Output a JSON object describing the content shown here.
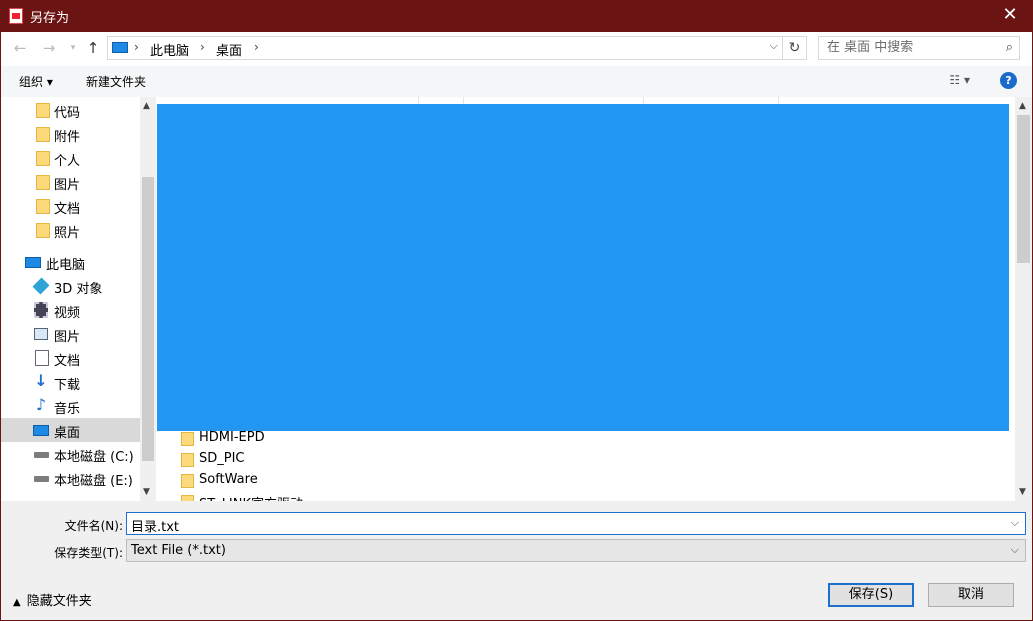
{
  "window": {
    "title": "另存为",
    "close_glyph": "✕"
  },
  "address": {
    "crumbs": [
      "此电脑",
      "桌面"
    ],
    "separator": "›",
    "search_placeholder": "在 桌面 中搜索"
  },
  "toolbar": {
    "organize_label": "组织 ▾",
    "new_folder_label": "新建文件夹",
    "help_label": "?"
  },
  "sidebar": {
    "items": [
      {
        "label": "代码",
        "icon": "folder-icon"
      },
      {
        "label": "附件",
        "icon": "folder-icon"
      },
      {
        "label": "个人",
        "icon": "folder-icon"
      },
      {
        "label": "图片",
        "icon": "folder-icon"
      },
      {
        "label": "文档",
        "icon": "folder-icon"
      },
      {
        "label": "照片",
        "icon": "folder-icon"
      },
      {
        "label": "此电脑",
        "icon": "computer-icon"
      },
      {
        "label": "3D 对象",
        "icon": "3d-objects-icon"
      },
      {
        "label": "视频",
        "icon": "video-icon"
      },
      {
        "label": "图片",
        "icon": "pictures-icon"
      },
      {
        "label": "文档",
        "icon": "documents-icon"
      },
      {
        "label": "下载",
        "icon": "download-icon"
      },
      {
        "label": "音乐",
        "icon": "music-icon"
      },
      {
        "label": "桌面",
        "icon": "desktop-icon",
        "selected": true
      },
      {
        "label": "本地磁盘 (C:)",
        "icon": "drive-icon"
      },
      {
        "label": "本地磁盘 (E:)",
        "icon": "drive-icon"
      }
    ]
  },
  "files": [
    {
      "name": "HDMI-EPD"
    },
    {
      "name": "SD_PIC"
    },
    {
      "name": "SoftWare"
    },
    {
      "name": "ST_LINK官方驱动"
    }
  ],
  "bottom": {
    "filename_label": "文件名(N):",
    "filename_value": "目录.txt",
    "filetype_label": "保存类型(T):",
    "filetype_value": "Text File (*.txt)",
    "hide_folders_label": "隐藏文件夹",
    "save_label": "保存(S)",
    "cancel_label": "取消"
  },
  "colors": {
    "titlebar": "#6b1414",
    "overlay": "#2196f3",
    "accent": "#1e6fd0"
  }
}
